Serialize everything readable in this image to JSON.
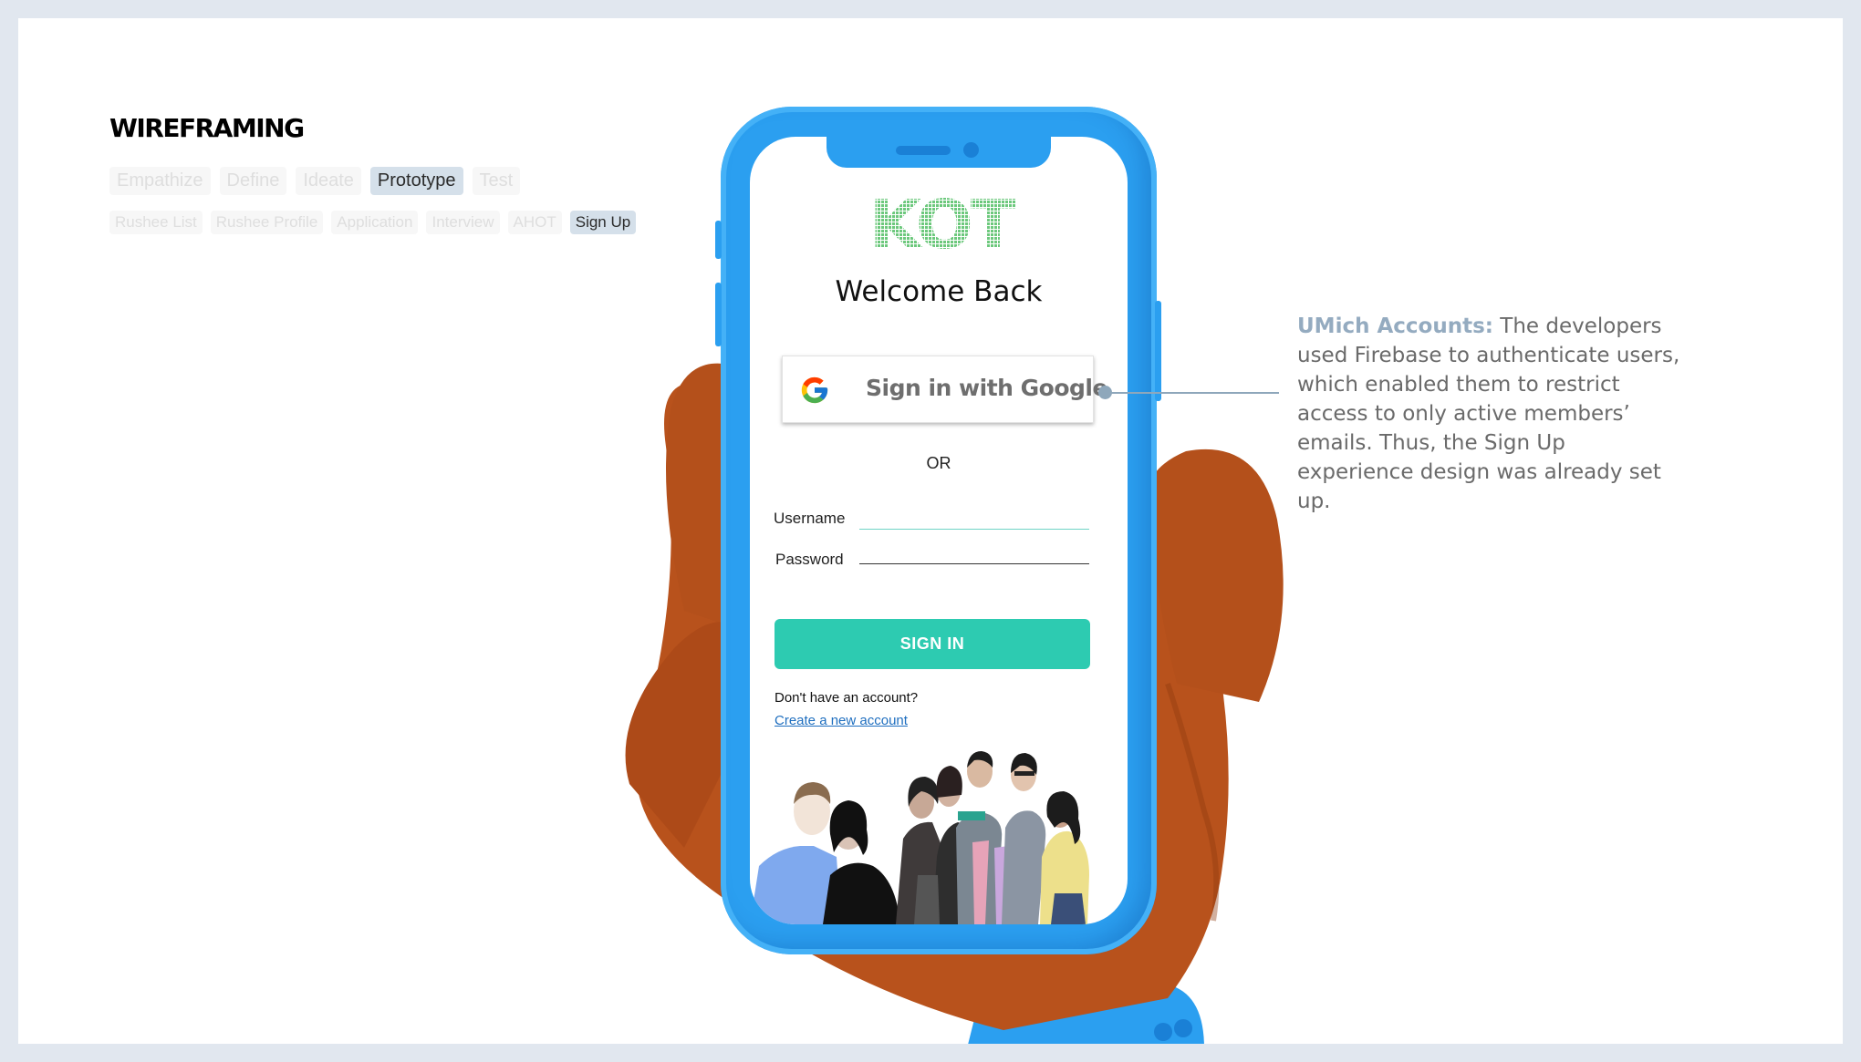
{
  "slide": {
    "title": "WIREFRAMING",
    "phase_tabs": [
      "Empathize",
      "Define",
      "Ideate",
      "Prototype",
      "Test"
    ],
    "active_phase": "Prototype",
    "screen_tabs": [
      "Rushee List",
      "Rushee Profile",
      "Application",
      "Interview",
      "AHOT",
      "Sign Up"
    ],
    "active_screen": "Sign Up"
  },
  "phone": {
    "logo_text": "KOT",
    "welcome": "Welcome Back",
    "google_button": "Sign in with Google",
    "or_text": "OR",
    "username_label": "Username",
    "password_label": "Password",
    "signin_button": "SIGN IN",
    "no_account_text": "Don't have an account?",
    "create_account_link": "Create a new account"
  },
  "annotation": {
    "heading": "UMich Accounts:",
    "body": " The developers used Firebase to authenticate users, which enabled them to restrict access to only active members’ emails. Thus, the Sign Up experience design was already set up."
  },
  "colors": {
    "phone_body": "#2b9ff0",
    "signin_button": "#2dcbb1",
    "annotation_heading": "#94abc0",
    "hand": "#b8521c"
  }
}
